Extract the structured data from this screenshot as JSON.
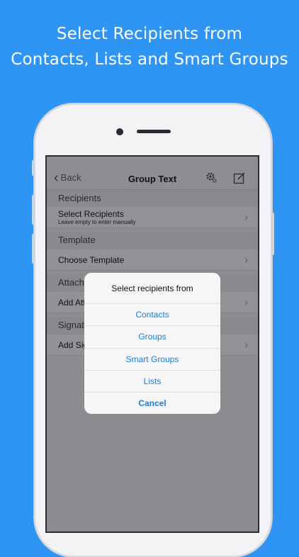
{
  "headline": {
    "line1": "Select Recipients from",
    "line2": "Contacts, Lists and Smart Groups"
  },
  "navbar": {
    "back_label": "Back",
    "title": "Group Text",
    "icons": [
      "chevron-left-icon",
      "gear-icon",
      "compose-icon"
    ]
  },
  "sections": {
    "recipients": "Recipients",
    "template": "Template",
    "attach": "Attach",
    "signature": "Signat"
  },
  "rows": {
    "select_recipients": "Select Recipients",
    "select_recipients_sub": "Leave empty to enter manually",
    "choose_template": "Choose Template",
    "add_attachment": "Add Att",
    "add_signature": "Add Sig"
  },
  "dialog": {
    "title": "Select recipients from",
    "options": [
      "Contacts",
      "Groups",
      "Smart Groups",
      "Lists"
    ],
    "cancel": "Cancel"
  },
  "colors": {
    "background": "#2f95f5",
    "accent": "#1a7fe0"
  }
}
